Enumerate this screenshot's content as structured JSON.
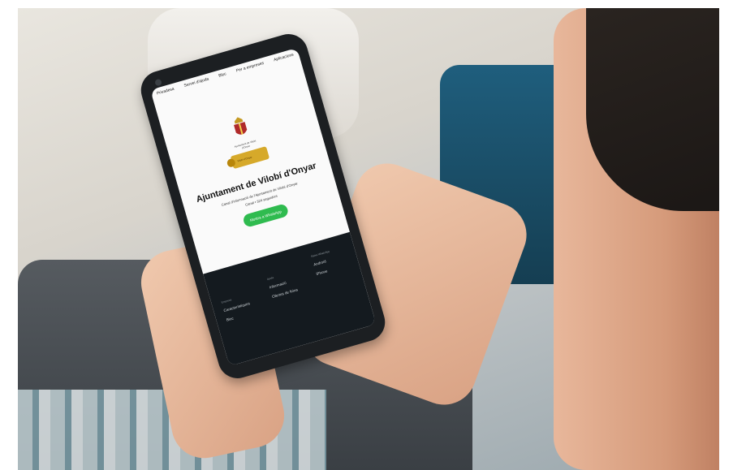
{
  "phone": {
    "nav": [
      "Privadesa",
      "Servei d'ajuda",
      "Bloc",
      "Per a empreses",
      "Aplicacions"
    ],
    "crest_caption": "Ajuntament de Vilobí d'Onyar",
    "badge_caption": "Vilobí d'Onyar",
    "title": "Ajuntament de Vilobí d'Onyar",
    "subtitle_line1": "Canal d'informació de l'Ajuntament de Vilobí d'Onyar",
    "subtitle_line2": "Canal • 324 seguidors",
    "cta_label": "Mostra a WhatsApp",
    "footer": {
      "col1": {
        "heading": "Empresa",
        "items": [
          "Característiques",
          "Bloc"
        ]
      },
      "col2": {
        "heading": "Ajuda",
        "items": [
          "Informació",
          "Ofertes de feina"
        ]
      },
      "col3": {
        "heading": "Baixa WhatsApp",
        "items": [
          "Android",
          "iPhone"
        ]
      }
    }
  },
  "colors": {
    "cta_green": "#2fbb4f",
    "footer_dark": "#141a1f",
    "badge_gold": "#d6a92a"
  }
}
